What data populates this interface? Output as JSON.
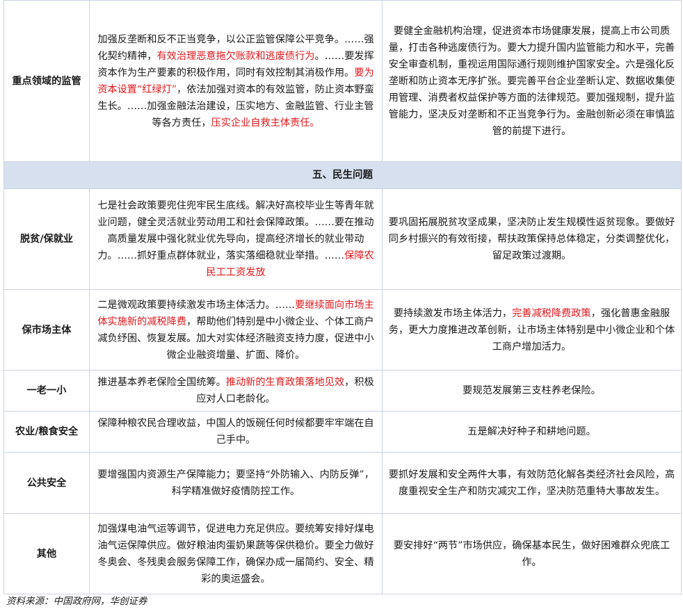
{
  "rows": [
    {
      "category": "重点领域的监管",
      "col2": [
        {
          "t": "加强反垄断和反不正当竞争，以公正监管保障公平竞争。……强化契约精神，",
          "red": false
        },
        {
          "t": "有效治理恶意拖欠账款和逃废债行为",
          "red": true
        },
        {
          "t": "。……要发挥资本作为生产要素的积极作用，同时有效控制其消极作用。",
          "red": false
        },
        {
          "t": "要为资本设置“红绿灯”",
          "red": true
        },
        {
          "t": "，依法加强对资本的有效监管，防止资本野蛮生长。……加强金融法治建设，压实地方、金融监管、行业主管等各方责任，",
          "red": false
        },
        {
          "t": "压实企业自救主体责任。",
          "red": true
        }
      ],
      "col3": [
        {
          "t": "要健全金融机构治理，促进资本市场健康发展，提高上市公司质量，打击各种逃废债行为。要大力提升国内监管能力和水平，完善安全审查机制，重视运用国际通行规则维护国家安全。六是强化反垄断和防止资本无序扩张。要完善平台企业垄断认定、数据收集使用管理、消费者权益保护等方面的法律规范。要加强规制，提升监管能力，坚决反对垄断和不正当竞争行为。金融创新必须在审慎监管的前提下进行。",
          "red": false
        }
      ]
    },
    {
      "section": "五、民生问题"
    },
    {
      "category": "脱贫/保就业",
      "col2": [
        {
          "t": "七是社会政策要兜住兜牢民生底线。解决好高校毕业生等青年就业问题，健全灵活就业劳动用工和社会保障政策。……要在推动高质量发展中强化就业优先导向，提高经济增长的就业带动力。……抓好重点群体就业，落实落细稳就业举措。……",
          "red": false
        },
        {
          "t": "保障农民工工资发放",
          "red": true
        }
      ],
      "col3": [
        {
          "t": "要巩固拓展脱贫攻坚成果，坚决防止发生规模性返贫现象。要做好同乡村振兴的有效衔接，帮扶政策保持总体稳定，分类调整优化，留足政策过渡期。",
          "red": false
        }
      ]
    },
    {
      "category": "保市场主体",
      "col2": [
        {
          "t": "二是微观政策要持续激发市场主体活力。……",
          "red": false
        },
        {
          "t": "要继续面向市场主体实施新的减税降费",
          "red": true
        },
        {
          "t": "，帮助他们特别是中小微企业、个体工商户减负纾困、恢复发展。加大对实体经济融资支持力度，促进中小微企业融资增量、扩面、降价。",
          "red": false
        }
      ],
      "col3": [
        {
          "t": "要持续激发市场主体活力，",
          "red": false
        },
        {
          "t": "完善减税降费政策",
          "red": true
        },
        {
          "t": "，强化普惠金融服务，更大力度推进改革创新，让市场主体特别是中小微企业和个体工商户增加活力。",
          "red": false
        }
      ]
    },
    {
      "category": "一老一小",
      "col2": [
        {
          "t": "推进基本养老保险全国统筹。",
          "red": false
        },
        {
          "t": "推动新的生育政策落地见效",
          "red": true
        },
        {
          "t": "，积极应对人口老龄化。",
          "red": false
        }
      ],
      "col3": [
        {
          "t": "要规范发展第三支柱养老保险。",
          "red": false
        }
      ]
    },
    {
      "category": "农业/粮食安全",
      "col2": [
        {
          "t": "保障种粮农民合理收益，中国人的饭碗任何时候都要牢牢端在自己手中。",
          "red": false
        }
      ],
      "col3": [
        {
          "t": "五是解决好种子和耕地问题。",
          "red": false
        }
      ]
    },
    {
      "category": "公共安全",
      "col2": [
        {
          "t": "要增强国内资源生产保障能力；要坚持“外防输入、内防反弹”，科学精准做好疫情防控工作。",
          "red": false
        }
      ],
      "col3": [
        {
          "t": "要抓好发展和安全两件大事，有效防范化解各类经济社会风险，高度重视安全生产和防灾减灾工作，坚决防范重特大事故发生。",
          "red": false
        }
      ]
    },
    {
      "category": "其他",
      "col2": [
        {
          "t": "加强煤电油气运等调节，促进电力充足供应。要统筹安排好煤电油气运保障供应。做好粮油肉蛋奶果蔬等保供稳价。要全力做好冬奥会、冬残奥会服务保障工作，确保办成一届简约、安全、精彩的奥运盛会。",
          "red": false
        }
      ],
      "col3": [
        {
          "t": "要安排好“两节”市场供应，确保基本民生，做好困难群众兜底工作。",
          "red": false
        }
      ]
    }
  ],
  "source_note": "资料来源：中国政府网，华创证券",
  "colors": {
    "highlight": "#e0191c",
    "section_bg": "#d6e0ee",
    "border": "#c9d3e3"
  }
}
